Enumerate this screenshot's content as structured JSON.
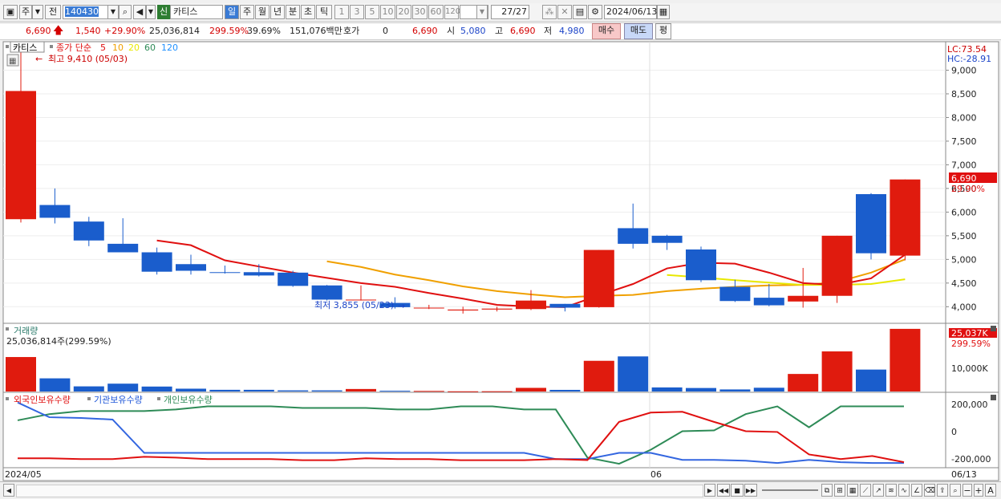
{
  "toolbar": {
    "mode_label": "주",
    "prev_label": "전",
    "code": "140430",
    "sin_badge": "신",
    "stock_name": "카티스",
    "periods": [
      "일",
      "주",
      "월",
      "년",
      "분",
      "초",
      "틱"
    ],
    "ticks": [
      "1",
      "3",
      "5",
      "10",
      "20",
      "30",
      "60",
      "120"
    ],
    "count": "27",
    "count_total": "/27",
    "date": "2024/06/13"
  },
  "quote": {
    "price": "6,690",
    "change": "1,540",
    "change_pct": "+29.90%",
    "volume": "25,036,814",
    "volume_pct": "299.59%",
    "turnover": "39.69%",
    "amount": "151,076백만",
    "hoga_label": "호가",
    "hoga_value": "0",
    "hoga_price": "6,690",
    "open_label": "시",
    "open": "5,080",
    "high_label": "고",
    "high": "6,690",
    "low_label": "저",
    "low": "4,980",
    "buy_label": "매수",
    "sell_label": "매도",
    "flat_label": "평"
  },
  "chart_legend": {
    "name": "카티스",
    "ma_title": "종가 단순",
    "ma_periods": [
      "5",
      "10",
      "20",
      "60",
      "120"
    ],
    "ma_colors": [
      "#e01010",
      "#f0a000",
      "#e8e800",
      "#2e8b57",
      "#1e90ff"
    ],
    "high_note": "최고 9,410 (05/03)",
    "low_note": "최저 3,855 (05/23)",
    "lc": "LC:73.54",
    "hc": "HC:-28.91",
    "last_price": "6,690",
    "last_pct": "29.90%"
  },
  "volume_panel": {
    "title": "거래량",
    "value": "25,036,814주(299.59%)",
    "last": "25,037K",
    "last_pct": "299.59%",
    "axis_label": "10,000K"
  },
  "holders_panel": {
    "legend": [
      "외국인보유수량",
      "기관보유수량",
      "개인보유수량"
    ],
    "axis": [
      "200,000",
      "0",
      "-200,000"
    ]
  },
  "x_axis": {
    "start": "2024/05",
    "mid": "06",
    "end": "06/13"
  },
  "chart_data": {
    "type": "candlestick",
    "price_axis": [
      "9,000",
      "8,500",
      "8,000",
      "7,500",
      "7,000",
      "6,500",
      "6,000",
      "5,500",
      "5,000",
      "4,500",
      "4,000"
    ],
    "ylim": [
      3700,
      9500
    ],
    "candles": [
      {
        "o": 5850,
        "h": 9410,
        "l": 5780,
        "c": 8560
      },
      {
        "o": 6150,
        "h": 6500,
        "l": 5760,
        "c": 5880
      },
      {
        "o": 5800,
        "h": 5900,
        "l": 5280,
        "c": 5400
      },
      {
        "o": 5330,
        "h": 5870,
        "l": 5150,
        "c": 5150
      },
      {
        "o": 5150,
        "h": 5250,
        "l": 4680,
        "c": 4740
      },
      {
        "o": 4900,
        "h": 5100,
        "l": 4680,
        "c": 4760
      },
      {
        "o": 4730,
        "h": 4870,
        "l": 4700,
        "c": 4720
      },
      {
        "o": 4730,
        "h": 4900,
        "l": 4640,
        "c": 4660
      },
      {
        "o": 4720,
        "h": 4760,
        "l": 4420,
        "c": 4440
      },
      {
        "o": 4450,
        "h": 4460,
        "l": 4130,
        "c": 4150
      },
      {
        "o": 4150,
        "h": 4450,
        "l": 4130,
        "c": 4150
      },
      {
        "o": 4080,
        "h": 4200,
        "l": 3960,
        "c": 3990
      },
      {
        "o": 3980,
        "h": 4040,
        "l": 3950,
        "c": 3980
      },
      {
        "o": 3920,
        "h": 4000,
        "l": 3855,
        "c": 3940
      },
      {
        "o": 3940,
        "h": 4000,
        "l": 3900,
        "c": 3960
      },
      {
        "o": 3950,
        "h": 4350,
        "l": 3930,
        "c": 4130
      },
      {
        "o": 4060,
        "h": 4060,
        "l": 3900,
        "c": 3980
      },
      {
        "o": 3990,
        "h": 5200,
        "l": 3980,
        "c": 5200
      },
      {
        "o": 5660,
        "h": 6180,
        "l": 5230,
        "c": 5330
      },
      {
        "o": 5500,
        "h": 5520,
        "l": 5200,
        "c": 5350
      },
      {
        "o": 5210,
        "h": 5270,
        "l": 4520,
        "c": 4560
      },
      {
        "o": 4420,
        "h": 4570,
        "l": 4100,
        "c": 4120
      },
      {
        "o": 4190,
        "h": 4480,
        "l": 4010,
        "c": 4030
      },
      {
        "o": 4110,
        "h": 4820,
        "l": 3980,
        "c": 4230
      },
      {
        "o": 4230,
        "h": 5500,
        "l": 4080,
        "c": 5500
      },
      {
        "o": 6380,
        "h": 6400,
        "l": 5000,
        "c": 5130
      },
      {
        "o": 5080,
        "h": 6690,
        "l": 4980,
        "c": 6690
      }
    ],
    "ma5": [
      null,
      null,
      null,
      null,
      5400,
      5300,
      4980,
      4850,
      4720,
      4610,
      4500,
      4420,
      4290,
      4170,
      4040,
      4000,
      3990,
      4240,
      4480,
      4810,
      4930,
      4910,
      4720,
      4500,
      4460,
      4600,
      5100
    ],
    "ma10": [
      null,
      null,
      null,
      null,
      null,
      null,
      null,
      null,
      null,
      4960,
      4840,
      4680,
      4560,
      4430,
      4330,
      4260,
      4200,
      4230,
      4250,
      4330,
      4380,
      4420,
      4450,
      4460,
      4520,
      4720,
      5000
    ],
    "ma20": [
      null,
      null,
      null,
      null,
      null,
      null,
      null,
      null,
      null,
      null,
      null,
      null,
      null,
      null,
      null,
      null,
      null,
      null,
      null,
      4670,
      4620,
      4560,
      4510,
      4460,
      4460,
      4480,
      4580
    ],
    "volume": [
      5500,
      2100,
      820,
      1250,
      790,
      450,
      270,
      270,
      180,
      180,
      400,
      120,
      90,
      30,
      40,
      580,
      260,
      4900,
      5600,
      650,
      560,
      330,
      600,
      2800,
      6400,
      3500,
      10000
    ],
    "foreign_qty": [
      -185000,
      -185000,
      -190000,
      -190000,
      -175000,
      -180000,
      -190000,
      -190000,
      -190000,
      -197000,
      -197000,
      -185000,
      -190000,
      -190000,
      -197000,
      -197000,
      -197000,
      -190000,
      -196000,
      50000,
      110000,
      115000,
      50000,
      -10000,
      -15000,
      -160000,
      -190000,
      -170000,
      -210000
    ],
    "institution_qty": [
      175000,
      80000,
      75000,
      65000,
      -150000,
      -150000,
      -150000,
      -150000,
      -150000,
      -150000,
      -150000,
      -150000,
      -150000,
      -150000,
      -150000,
      -150000,
      -150000,
      -190000,
      -190000,
      -150000,
      -150000,
      -195000,
      -195000,
      -200000,
      -215000,
      -195000,
      -210000,
      -215000,
      -215000
    ],
    "individual_qty": [
      60000,
      100000,
      120000,
      120000,
      120000,
      130000,
      150000,
      150000,
      150000,
      140000,
      140000,
      140000,
      130000,
      130000,
      150000,
      150000,
      130000,
      130000,
      -180000,
      -220000,
      -130000,
      -10000,
      -5000,
      100000,
      150000,
      15000,
      150000,
      150000,
      150000
    ]
  }
}
